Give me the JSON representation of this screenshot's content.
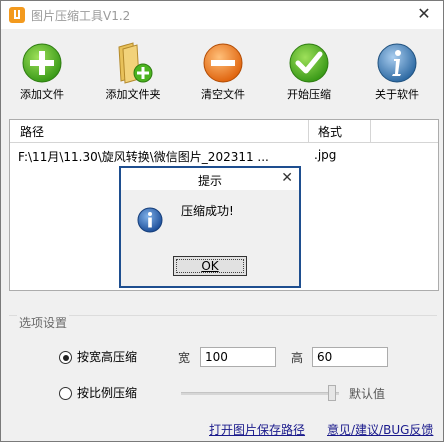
{
  "window": {
    "title": "图片压缩工具V1.2",
    "close_glyph": "✕"
  },
  "toolbar": {
    "items": [
      {
        "label": "添加文件",
        "icon": "add-icon",
        "color": "#4cb320"
      },
      {
        "label": "添加文件夹",
        "icon": "folder-add-icon",
        "color": "#e8c15a"
      },
      {
        "label": "清空文件",
        "icon": "minus-icon",
        "color": "#f07c1a"
      },
      {
        "label": "开始压缩",
        "icon": "check-icon",
        "color": "#4cb320"
      },
      {
        "label": "关于软件",
        "icon": "info-icon",
        "color": "#3c7fb5"
      }
    ]
  },
  "table": {
    "columns": [
      "路径",
      "格式"
    ],
    "rows": [
      {
        "path": "F:\\11月\\11.30\\旋风转换\\微信图片_202311 ...",
        "format": ".jpg"
      }
    ]
  },
  "options": {
    "legend": "选项设置",
    "mode_wh_label": "按宽高压缩",
    "mode_ratio_label": "按比例压缩",
    "selected_mode": "按宽高压缩",
    "width_label": "宽",
    "width_value": "100",
    "height_label": "高",
    "height_value": "60",
    "default_label": "默认值",
    "slider_value": 0.95
  },
  "footer": {
    "open_path_link": "打开图片保存路径",
    "feedback_link": "意见/建议/BUG反馈"
  },
  "dialog": {
    "title": "提示",
    "message": "压缩成功!",
    "ok_label": "OK",
    "close_glyph": "✕",
    "icon": "info-icon"
  }
}
